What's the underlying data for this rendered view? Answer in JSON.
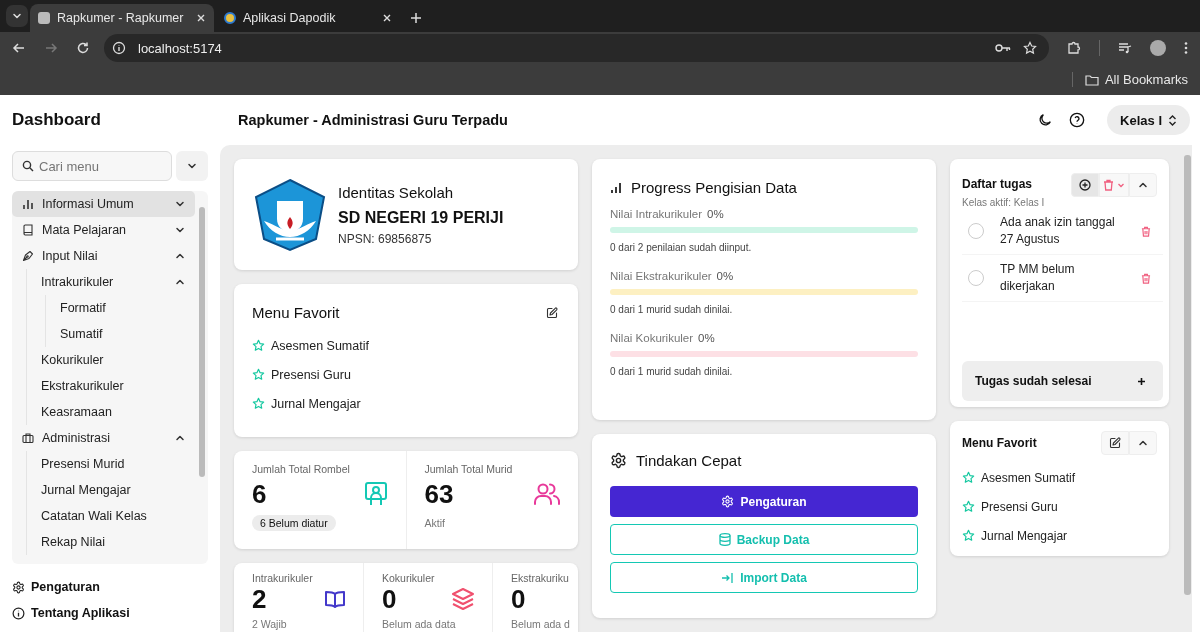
{
  "browser": {
    "tabs": [
      {
        "title": "Rapkumer - Rapkumer",
        "selected": true
      },
      {
        "title": "Aplikasi Dapodik",
        "selected": false
      }
    ],
    "address": "localhost:5174",
    "bookmarks": [
      "All Bookmarks"
    ]
  },
  "sidebar": {
    "title": "Dashboard",
    "search": {
      "placeholder": "Cari menu"
    },
    "items": [
      {
        "label": "Informasi Umum",
        "selected": true,
        "expanded": false
      },
      {
        "label": "Mata Pelajaran",
        "selected": false,
        "expanded": false
      },
      {
        "label": "Input Nilai",
        "selected": false,
        "expanded": true,
        "children": [
          {
            "label": "Intrakurikuler",
            "selected": false,
            "expanded": true,
            "children": [
              {
                "label": "Formatif",
                "selected": false
              },
              {
                "label": "Sumatif",
                "selected": false
              }
            ]
          },
          {
            "label": "Kokurikuler",
            "selected": false
          },
          {
            "label": "Ekstrakurikuler",
            "selected": false
          },
          {
            "label": "Keasramaan",
            "selected": false
          }
        ]
      },
      {
        "label": "Administrasi",
        "selected": false,
        "expanded": true,
        "children": [
          {
            "label": "Presensi Murid",
            "selected": false
          },
          {
            "label": "Jurnal Mengajar",
            "selected": false
          },
          {
            "label": "Catatan Wali Kelas",
            "selected": false
          },
          {
            "label": "Rekap Nilai",
            "selected": false
          }
        ]
      }
    ],
    "footer": [
      "Pengaturan",
      "Tentang Aplikasi"
    ]
  },
  "header": {
    "title": "Rapkumer - Administrasi Guru Terpadu",
    "class_select": "Kelas I"
  },
  "school": {
    "heading": "Identitas Sekolah",
    "name": "SD NEGERI 19 PERIJI",
    "npsn": "NPSN: 69856875"
  },
  "favorites": {
    "title": "Menu Favorit",
    "items": [
      "Asesmen Sumatif",
      "Presensi Guru",
      "Jurnal Mengajar"
    ]
  },
  "summary": [
    {
      "label": "Jumlah Total Rombel",
      "value": "6",
      "note": "6 Belum diatur",
      "kind": "badge",
      "color": "#14c8b4"
    },
    {
      "label": "Jumlah Total Murid",
      "value": "63",
      "note": "Aktif",
      "kind": "plain",
      "color": "#e8399a"
    }
  ],
  "assessments": [
    {
      "label": "Intrakurikuler",
      "value": "2",
      "note": "2 Wajib",
      "color": "#4338ca"
    },
    {
      "label": "Kokurikuler",
      "value": "0",
      "note": "Belum ada data",
      "color": "#f0506e"
    },
    {
      "label": "Ekstrakuriku",
      "value": "0",
      "note": "Belum ada d"
    }
  ],
  "progress": {
    "title": "Progress Pengisian Data",
    "rows": [
      {
        "label": "Nilai Intrakurikuler",
        "percent": "0%",
        "level": 0,
        "color": "#cff5e7",
        "caption": "0 dari 2 penilaian sudah diinput."
      },
      {
        "label": "Nilai Ekstrakurikuler",
        "percent": "0%",
        "level": 0,
        "color": "#fdf0c2",
        "caption": "0 dari 1 murid sudah dinilai."
      },
      {
        "label": "Nilai Kokurikuler",
        "percent": "0%",
        "level": 0,
        "color": "#fde0e5",
        "caption": "0 dari 1 murid sudah dinilai."
      }
    ]
  },
  "quick_actions": {
    "title": "Tindakan Cepat",
    "buttons": [
      {
        "label": "Pengaturan",
        "kind": "primary"
      },
      {
        "label": "Backup Data",
        "kind": "outline"
      },
      {
        "label": "Import Data",
        "kind": "outline"
      }
    ]
  },
  "tasks": {
    "title": "Daftar tugas",
    "subtitle": "Kelas aktif: Kelas I",
    "items": [
      {
        "text": "Ada anak izin tanggal 27 Agustus",
        "checked": false
      },
      {
        "text": "TP MM belum dikerjakan",
        "checked": false
      }
    ],
    "done_section": {
      "label": "Tugas sudah selesai",
      "expanded": false
    }
  },
  "favorites_panel": {
    "title": "Menu Favorit",
    "expanded": true,
    "items": [
      "Asesmen Sumatif",
      "Presensi Guru",
      "Jurnal Mengajar"
    ]
  }
}
